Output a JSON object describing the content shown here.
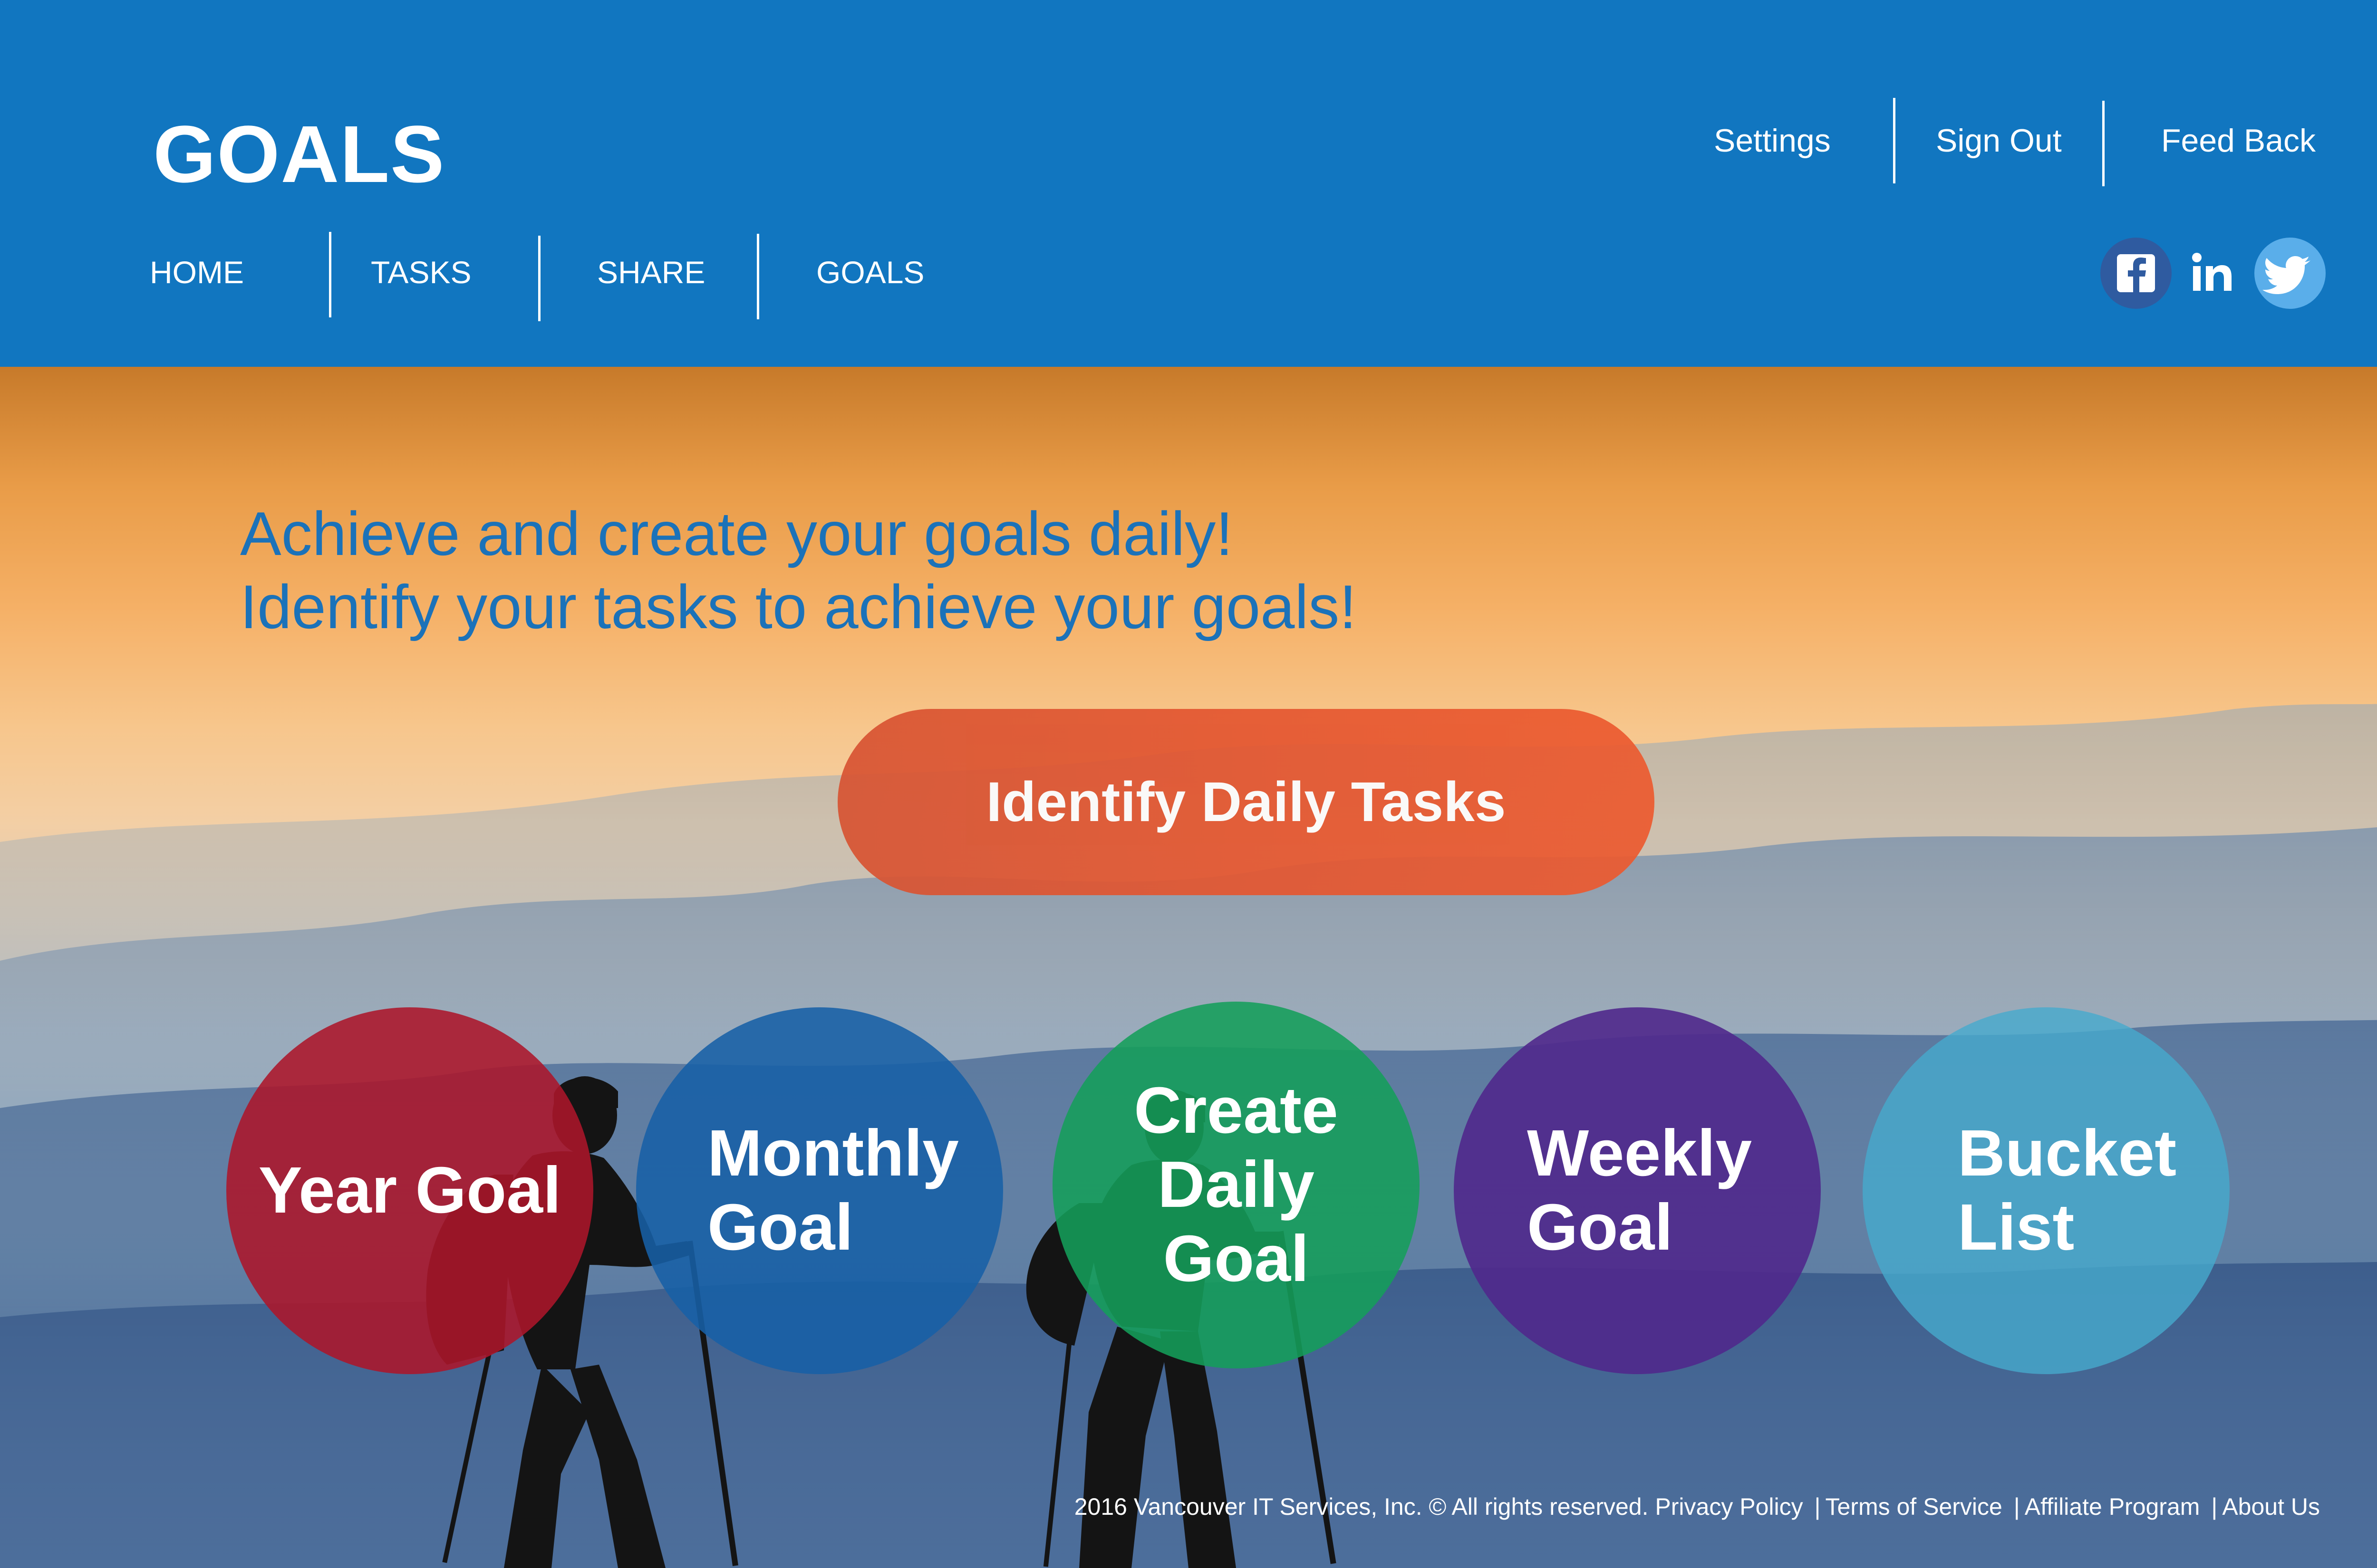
{
  "header": {
    "logo": "GOALS",
    "nav": [
      {
        "label": "HOME"
      },
      {
        "label": "TASKS"
      },
      {
        "label": "SHARE"
      },
      {
        "label": "GOALS"
      }
    ],
    "top_links": [
      {
        "label": "Settings"
      },
      {
        "label": "Sign Out"
      },
      {
        "label": "Feed Back"
      }
    ],
    "social": [
      {
        "icon": "facebook-icon",
        "color": "#2f5ba0"
      },
      {
        "icon": "linkedin-icon",
        "color": "#1176c0"
      },
      {
        "icon": "twitter-icon",
        "color": "#5aaeea"
      }
    ]
  },
  "hero": {
    "tagline_line1": "Achieve and create your goals daily!",
    "tagline_line2": "Identify your tasks to achieve your goals!",
    "cta_label": "Identify Daily Tasks",
    "goals": [
      {
        "label": "Year Goal",
        "color": "#ac162a"
      },
      {
        "label": "Monthly\nGoal",
        "color": "#1760a6"
      },
      {
        "label": "Create Daily\nGoal",
        "color": "#149e5a"
      },
      {
        "label": "Weekly\nGoal",
        "color": "#50288c"
      },
      {
        "label": "Bucket\nList",
        "color": "#46aacd"
      }
    ]
  },
  "footer": {
    "copyright": "2016 Vancouver IT Services, Inc. © All rights reserved.",
    "links": [
      "Privacy Policy",
      "Terms of Service",
      "Affiliate Program",
      "About Us"
    ],
    "separator": "|"
  },
  "colors": {
    "brand_blue": "#1176c0",
    "cta_orange": "#e45630",
    "tagline_blue": "#1b72b9"
  }
}
